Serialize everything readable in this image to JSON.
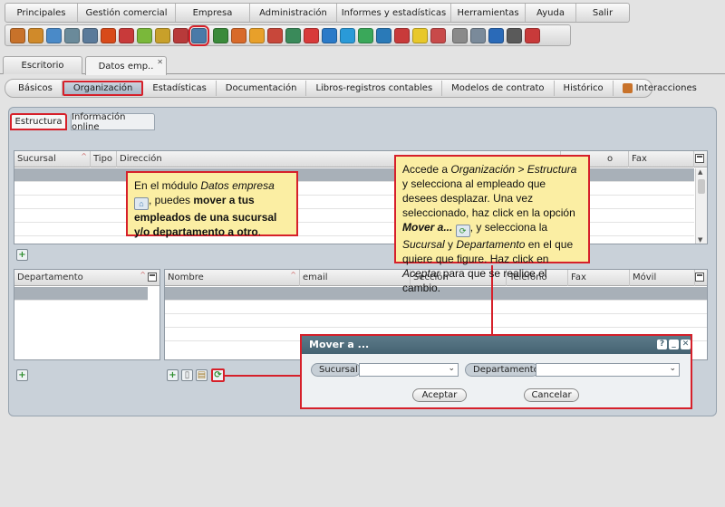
{
  "menu": [
    "Principales",
    "Gestión comercial",
    "Empresa",
    "Administración",
    "Informes y estadísticas",
    "Herramientas",
    "Ayuda",
    "Salir"
  ],
  "toolbar_icons": [
    {
      "name": "box-icon",
      "color": "#c8722a"
    },
    {
      "name": "people-icon",
      "color": "#d08a2a"
    },
    {
      "name": "person-icon",
      "color": "#4a8ac8"
    },
    {
      "name": "window-icon",
      "color": "#6a8a9a"
    },
    {
      "name": "monitor-icon",
      "color": "#5a7a9a"
    },
    {
      "name": "fire-icon",
      "color": "#d84a1a"
    },
    {
      "name": "target-icon",
      "color": "#c83a3a"
    },
    {
      "name": "pencil-icon",
      "color": "#7ab83a"
    },
    {
      "name": "briefcase-icon",
      "color": "#c8a02a"
    },
    {
      "name": "bag-icon",
      "color": "#b83a3a"
    },
    {
      "name": "company-icon",
      "color": "#4a7aa8"
    },
    {
      "name": "door-icon",
      "color": "#3a8a3a"
    },
    {
      "name": "user-icon",
      "color": "#d86a2a"
    },
    {
      "name": "user-add-icon",
      "color": "#e8a02a"
    },
    {
      "name": "phone-list-icon",
      "color": "#c8473a"
    },
    {
      "name": "chart-icon",
      "color": "#3a8a5a"
    },
    {
      "name": "cycle-icon",
      "color": "#d83a3a"
    },
    {
      "name": "euro-icon",
      "color": "#2a7ac8"
    },
    {
      "name": "arrow-icon",
      "color": "#2a9ad8"
    },
    {
      "name": "diamond-icon",
      "color": "#3aa85a"
    },
    {
      "name": "calendar-icon",
      "color": "#2a7ab8"
    },
    {
      "name": "g-icon",
      "color": "#c83a3a"
    },
    {
      "name": "bulb-icon",
      "color": "#e8c82a"
    },
    {
      "name": "doc-icon",
      "color": "#c84a4a"
    },
    {
      "name": "note-icon",
      "color": "#8a8a8a"
    },
    {
      "name": "clipboard-icon",
      "color": "#7a8a9a"
    },
    {
      "name": "phone-icon",
      "color": "#2a6ab8"
    },
    {
      "name": "tools-icon",
      "color": "#5a5a5a"
    },
    {
      "name": "help-icon",
      "color": "#c83a3a"
    }
  ],
  "doc_tabs": {
    "escritorio": "Escritorio",
    "datos": "Datos emp.."
  },
  "module_tabs": [
    "Básicos",
    "Organización",
    "Estadísticas",
    "Documentación",
    "Libros-registros contables",
    "Modelos de contrato",
    "Histórico",
    "Interacciones"
  ],
  "sub_tabs": [
    "Estructura",
    "Información online"
  ],
  "grid_top": {
    "columns": [
      "Sucursal",
      "Tipo",
      "Dirección",
      "Fax"
    ],
    "partial": "o"
  },
  "grid_dept": {
    "columns": [
      "Departamento"
    ]
  },
  "grid_emp": {
    "columns": [
      "Nombre",
      "email",
      "Sección",
      "Teléfono",
      "Fax",
      "Móvil"
    ]
  },
  "callout_left": {
    "p1": "En el módulo ",
    "em1": "Datos empresa",
    "p2": ", puedes ",
    "b1": "mover a tus empleados de una sucursal y/o departamento a otro",
    "p3": "."
  },
  "callout_right": {
    "t1": "Accede a ",
    "em1": "Organización > Estructura",
    "t2": " y selecciona al empleado que desees desplazar. Una vez seleccionado, haz click en la opción ",
    "b1": "Mover a...",
    "t3": ", y selecciona la ",
    "em2": "Sucursal",
    "t4": " y ",
    "em3": "Departamento",
    "t5": " en el que quiere que figure. Haz click en ",
    "em4": "Aceptar",
    "t6": " para que se realice el cambio."
  },
  "dialog": {
    "title": "Mover a ...",
    "sucursal_label": "Sucursal",
    "departamento_label": "Departamento",
    "accept": "Aceptar",
    "cancel": "Cancelar"
  },
  "colors": {
    "highlight": "#d6202a",
    "callout_bg": "#fbeea3",
    "dialog_header": "#4f6d7c"
  }
}
